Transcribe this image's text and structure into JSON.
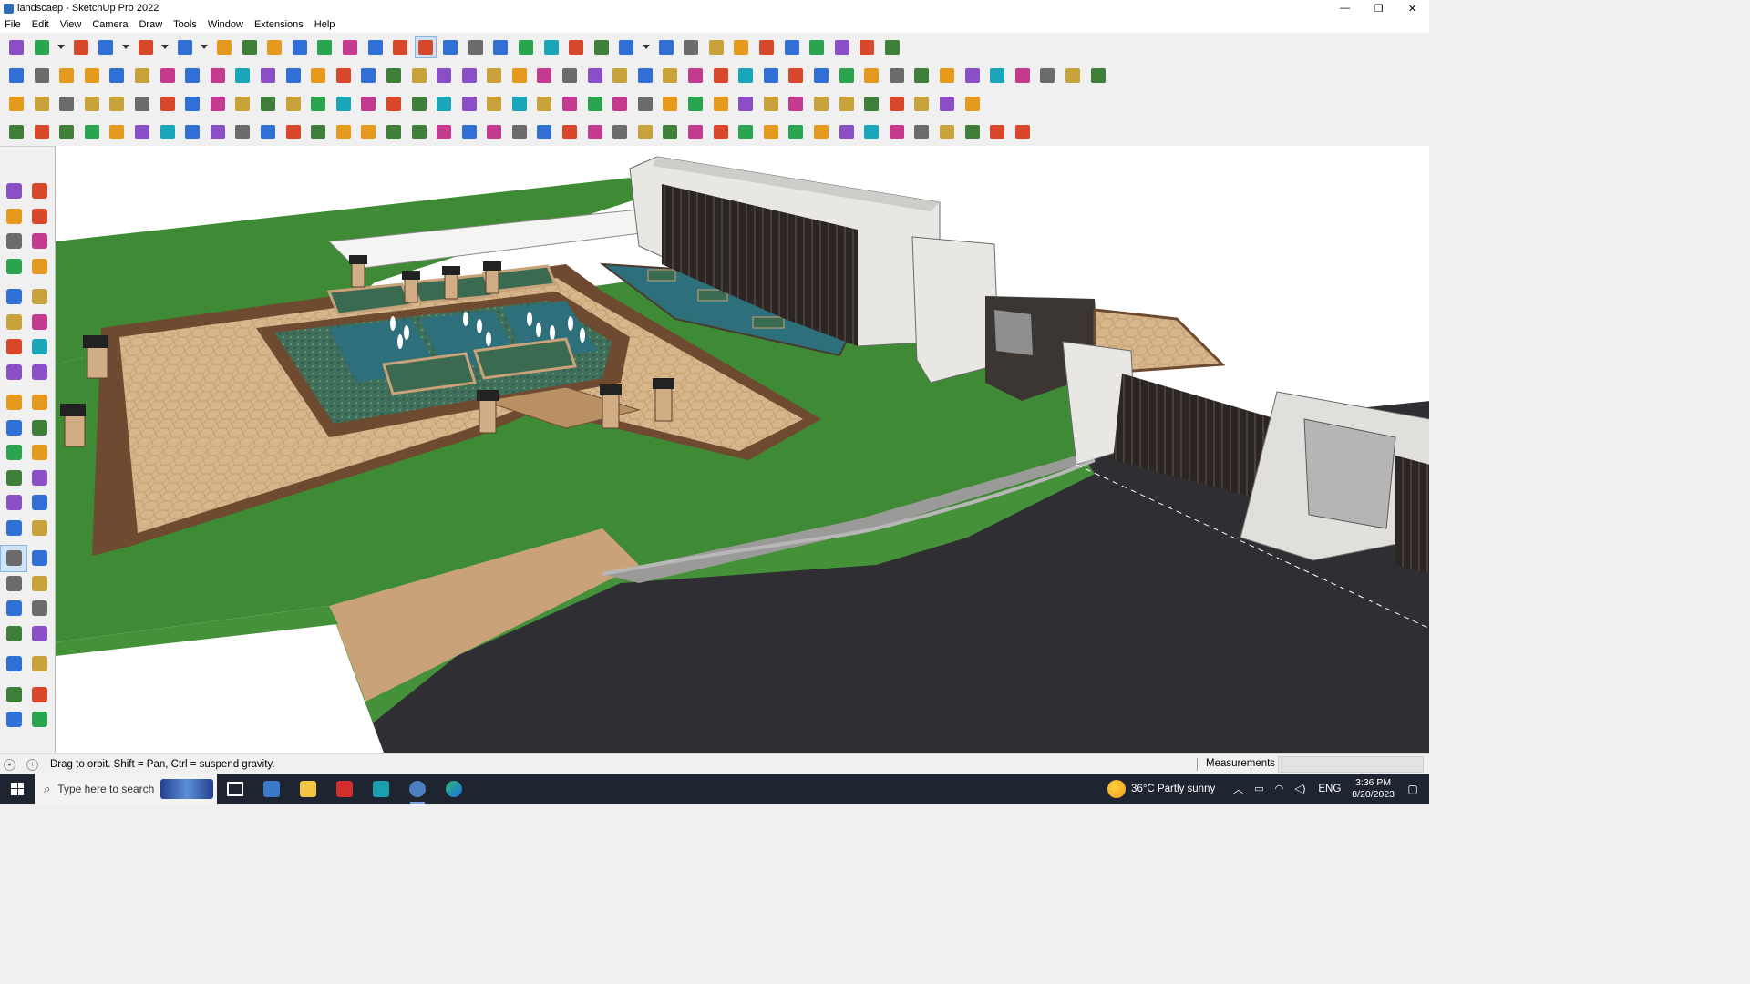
{
  "window": {
    "title": "landscaep - SketchUp Pro 2022",
    "controls": [
      "—",
      "❐",
      "✕"
    ]
  },
  "menu": [
    "File",
    "Edit",
    "View",
    "Camera",
    "Draw",
    "Tools",
    "Window",
    "Extensions",
    "Help"
  ],
  "status": {
    "hint": "Drag to orbit. Shift = Pan, Ctrl = suspend gravity.",
    "measurements_label": "Measurements",
    "measurements_value": ""
  },
  "taskbar": {
    "search_placeholder": "Type here to search",
    "weather": "36°C  Partly sunny",
    "language": "ENG",
    "time": "3:36 PM",
    "date": "8/20/2023"
  },
  "colors": {
    "grass": "#3f8a35",
    "paving": "#d9b98f",
    "road": "#2f2e32",
    "wall": "#e9e7e3",
    "water": "#2d6f7a",
    "accent": "#cfe3f7"
  },
  "toolbar_icons": {
    "row1": [
      "search-icon",
      "select-icon",
      "dropdown-icon",
      "eraser-icon",
      "pencil-icon",
      "dropdown-icon",
      "arc-icon",
      "dropdown-icon",
      "rectangle-icon",
      "dropdown-icon",
      "pushpull-icon",
      "followme-icon",
      "move-icon",
      "rotate-icon",
      "scale-icon",
      "tape-icon",
      "text-icon",
      "paint-icon",
      "orbit-icon",
      "pan-icon",
      "zoom-icon",
      "zoom-extents-icon",
      "styles-icon",
      "section-icon",
      "layers-icon",
      "sandbox-icon",
      "person-icon",
      "dropdown-icon",
      "warehouse-icon",
      "extension-icon",
      "flag-icon",
      "up-arrow-icon",
      "down-arrow-icon",
      "axes-icon",
      "xray-icon",
      "undo-icon",
      "redo-icon",
      "hand-icon"
    ],
    "row2": [
      "cube-icon",
      "cube-wire-icon",
      "cube-texture-icon",
      "solid-icon",
      "solid-union-icon",
      "solid-subtract-icon",
      "solid-trim-icon",
      "solid-intersect-icon",
      "solid-split-icon",
      "solid-outer-icon",
      "solid-shell-icon",
      "curve-icon",
      "view-front-icon",
      "view-right-icon",
      "view-back-icon",
      "landscape-icon",
      "landscape-2-icon",
      "house-front-icon",
      "house-side-icon",
      "house-icon",
      "house-outline-icon",
      "roof-icon",
      "gear-text-icon",
      "leaf-icon",
      "ruler-icon",
      "circle-dash-icon",
      "circle-icon",
      "polygon-icon",
      "ellipse-icon",
      "parallelogram-icon",
      "arc-2-icon",
      "curve-2-icon",
      "curve-3-icon",
      "curve-4-icon",
      "curve-5-icon",
      "paint-tool-icon",
      "eraser-2-icon",
      "material-1-icon",
      "material-2-icon",
      "material-3-icon",
      "material-4-icon",
      "material-5-icon",
      "material-6-icon",
      "material-7-icon"
    ],
    "row3": [
      "plane-blue-icon",
      "plane-blue-2-icon",
      "plane-yellow-icon",
      "label-icon",
      "plane-red-icon",
      "sheet-icon",
      "curl-icon",
      "square-red-icon",
      "list-icon",
      "panel-icon",
      "boxes-icon",
      "pipe-icon",
      "bracket-icon",
      "spline-icon",
      "plus-red-icon",
      "plus-green-icon",
      "cross-blue-icon",
      "flask-icon",
      "fountain-icon",
      "triangle-icon",
      "arc-orange-icon",
      "knot-icon",
      "loop-icon",
      "star-icon",
      "bucket-icon",
      "u-turn-icon",
      "gate-icon",
      "puzzle-1-icon",
      "puzzle-2-icon",
      "puzzle-3-icon",
      "tag-icon",
      "grid-icon",
      "filter-icon",
      "hatch-1-icon",
      "hatch-2-icon",
      "hatch-3-icon",
      "cross-red-icon",
      "dots-icon",
      "nodes-icon"
    ],
    "row4": [
      "line-tool-icon",
      "curve-tool-icon",
      "cloud-icon",
      "ruby-icon",
      "hand-1-icon",
      "hand-2-icon",
      "hand-3-icon",
      "ball-icon",
      "shell-icon",
      "spring-icon",
      "corner-icon",
      "corner-2-icon",
      "diag-red-icon",
      "bend-icon",
      "box-icon",
      "peak-icon",
      "fence-icon",
      "stairs-icon",
      "spiral-icon",
      "palm-icon",
      "leaf-2-icon",
      "arrow-icon",
      "ramp-icon",
      "rail-1-icon",
      "rail-2-icon",
      "rail-3-icon",
      "rail-4-icon",
      "arch-icon",
      "stripes-icon",
      "bench-icon",
      "hex-icon",
      "pattern-1-icon",
      "pattern-2-icon",
      "pattern-3-icon",
      "pattern-4-icon",
      "pattern-5-icon",
      "pattern-6-icon",
      "pattern-7-icon",
      "pattern-8-icon",
      "pattern-9-icon",
      "pattern-10-icon"
    ]
  },
  "left_tools": [
    "select-arrow-icon",
    "orbit-icon",
    "paint-bucket-icon",
    "eraser-icon",
    "component-icon",
    "tape-icon",
    "line-icon",
    "freehand-icon",
    "rectangle-icon",
    "rotated-rect-icon",
    "circle-icon",
    "polygon-icon",
    "arc-icon",
    "arc-2pt-icon",
    "arc-3pt-icon",
    "pie-icon",
    "move-icon",
    "pushpull-icon",
    "rotate-icon",
    "followme-icon",
    "scale-icon",
    "offset-icon",
    "tape-measure-icon",
    "dimension-icon",
    "protractor-icon",
    "text-icon",
    "axes-icon",
    "3dtext-icon",
    "orbit-active-icon",
    "pan-icon",
    "zoom-icon",
    "zoom-window-icon",
    "zoom-extents-icon",
    "previous-view-icon",
    "position-camera-icon",
    "lookaround-icon",
    "walk-icon",
    "section-plane-icon",
    "sandbox-1-icon",
    "sandbox-2-icon",
    "sandbox-3-icon",
    "sandbox-4-icon"
  ]
}
